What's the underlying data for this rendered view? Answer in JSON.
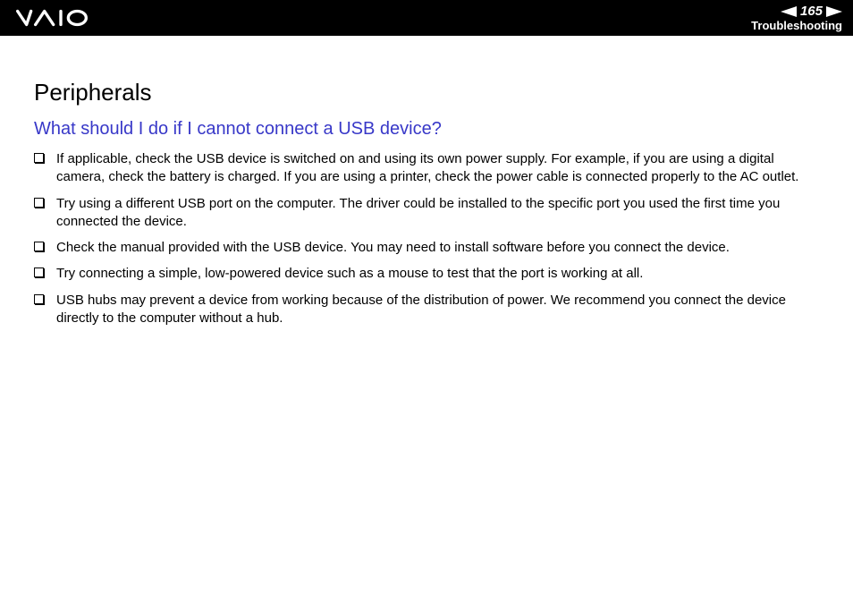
{
  "header": {
    "page_number": "165",
    "section_label": "Troubleshooting"
  },
  "content": {
    "title": "Peripherals",
    "subtitle": "What should I do if I cannot connect a USB device?",
    "items": {
      "0": "If applicable, check the USB device is switched on and using its own power supply. For example, if you are using a digital camera, check the battery is charged. If you are using a printer, check the power cable is connected properly to the AC outlet.",
      "1": "Try using a different USB port on the computer. The driver could be installed to the specific port you used the first time you connected the device.",
      "2": "Check the manual provided with the USB device. You may need to install software before you connect the device.",
      "3": "Try connecting a simple, low-powered device such as a mouse to test that the port is working at all.",
      "4": "USB hubs may prevent a device from working because of the distribution of power. We recommend you connect the device directly to the computer without a hub."
    }
  }
}
